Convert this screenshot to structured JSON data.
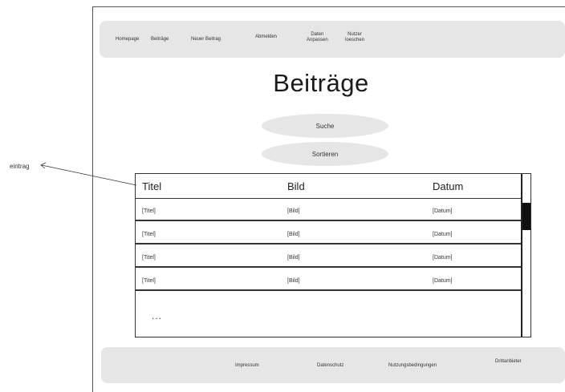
{
  "nav": {
    "items": [
      {
        "label": "Homepage"
      },
      {
        "label": "Beiträge"
      },
      {
        "label": "Neuer Beitrag"
      },
      {
        "label": "Abmelden"
      },
      {
        "label": "Daten\nAnpassen"
      },
      {
        "label": "Nutzer\nloeschen"
      }
    ]
  },
  "page": {
    "title": "Beiträge",
    "search_label": "Suche",
    "sort_label": "Sortieren"
  },
  "table": {
    "headers": [
      "Titel",
      "Bild",
      "Datum"
    ],
    "rows": [
      [
        "[Titel]",
        "[Bild]",
        "[Datum]"
      ],
      [
        "[Titel]",
        "[Bild]",
        "[Datum]"
      ],
      [
        "[Titel]",
        "[Bild]",
        "[Datum]"
      ],
      [
        "[Titel]",
        "[Bild]",
        "[Datum]"
      ]
    ],
    "more": "..."
  },
  "footer": {
    "items": [
      {
        "label": "Impressum"
      },
      {
        "label": "Datenschutz"
      },
      {
        "label": "Nutzungsbedingungen"
      },
      {
        "label": "Drittanbieter"
      }
    ]
  },
  "annotation": {
    "label": "eintrag"
  }
}
